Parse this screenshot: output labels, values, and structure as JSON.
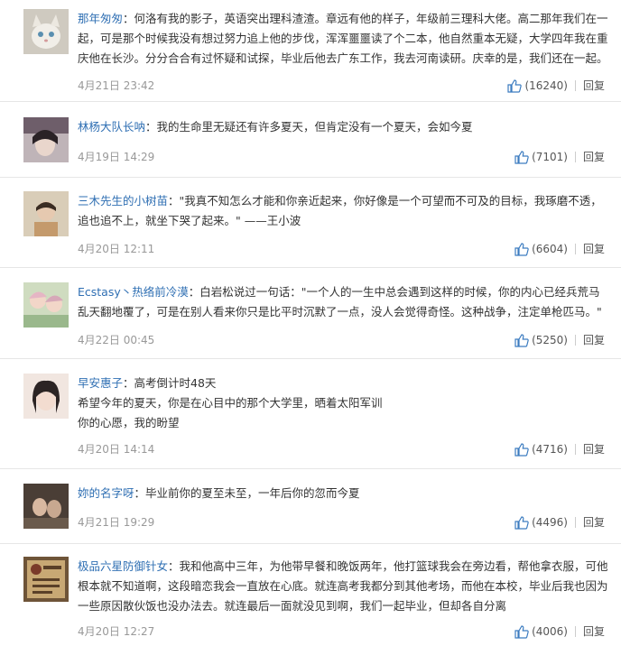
{
  "comments": [
    {
      "username": "那年匆匆",
      "text": "何洛有我的影子，英语突出理科渣渣。章远有他的样子，年级前三理科大佬。高二那年我们在一起，可是那个时候我没有想过努力追上他的步伐，浑浑噩噩读了个二本，他自然重本无疑，大学四年我在重庆他在长沙。分分合合有过怀疑和试探，毕业后他去广东工作，我去河南读研。庆幸的是，我们还在一起。",
      "time": "4月21日 23:42",
      "likes": "(16240)",
      "reply": "回复",
      "avatar_color": "#d8d4cc"
    },
    {
      "username": "林杨大队长呐",
      "text": "我的生命里无疑还有许多夏天，但肯定没有一个夏天，会如今夏",
      "time": "4月19日 14:29",
      "likes": "(7101)",
      "reply": "回复",
      "avatar_color": "#7a6a70"
    },
    {
      "username": "三木先生的小树苗",
      "text": "\"我真不知怎么才能和你亲近起来，你好像是一个可望而不可及的目标，我琢磨不透，追也追不上，就坐下哭了起来。\" ——王小波",
      "time": "4月20日 12:11",
      "likes": "(6604)",
      "reply": "回复",
      "avatar_color": "#c9b9a0"
    },
    {
      "username": "Ecstasy丶热络前冷漠",
      "text": "白岩松说过一句话：\"一个人的一生中总会遇到这样的时候，你的内心已经兵荒马乱天翻地覆了，可是在别人看来你只是比平时沉默了一点，没人会觉得奇怪。这种战争，注定单枪匹马。\"",
      "time": "4月22日 00:45",
      "likes": "(5250)",
      "reply": "回复",
      "avatar_color": "#b4c8a8"
    },
    {
      "username": "早安惠子",
      "text": "高考倒计时48天\n希望今年的夏天，你是在心目中的那个大学里，晒着太阳军训\n你的心愿，我的盼望",
      "time": "4月20日 14:14",
      "likes": "(4716)",
      "reply": "回复",
      "avatar_color": "#e8d8d0"
    },
    {
      "username": "妳的名字呀",
      "text": "毕业前你的夏至未至，一年后你的忽而今夏",
      "time": "4月21日 19:29",
      "likes": "(4496)",
      "reply": "回复",
      "avatar_color": "#5a4a40"
    },
    {
      "username": "极品六星防御针女",
      "text": "我和他高中三年，为他带早餐和晚饭两年，他打篮球我会在旁边看，帮他拿衣服，可他根本就不知道啊，这段暗恋我会一直放在心底。就连高考我都分到其他考场，而他在本校，毕业后我也因为一些原因散伙饭也没办法去。就连最后一面就没见到啊，我们一起毕业，但却各自分离",
      "time": "4月20日 12:27",
      "likes": "(4006)",
      "reply": "回复",
      "avatar_color": "#8a6e4e"
    }
  ]
}
